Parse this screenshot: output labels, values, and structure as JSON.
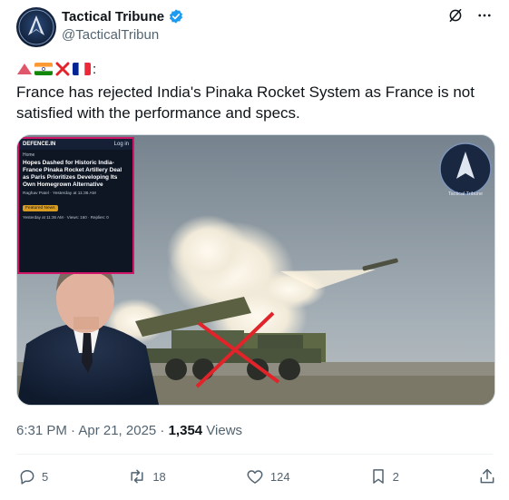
{
  "author": {
    "display_name": "Tactical Tribune",
    "handle": "@TacticalTribun"
  },
  "tweet": {
    "emoji_suffix": ":",
    "text": "France has rejected India's Pinaka Rocket System as France is not satisfied with the performance and specs."
  },
  "media": {
    "inset": {
      "site_label": "DEFENCE.IN",
      "login": "Log in",
      "breadcrumb": "Home",
      "headline": "Hopes Dashed for Historic India-France Pinaka Rocket Artillery Deal as Paris Prioritizes Developing Its Own Homegrown Alternative",
      "author_line": "Raghav Patel  ·  Yesterday at 11:36 AM",
      "tag": "Featured News",
      "stats": "Yesterday at 11:36 AM  ·  Views: 160  ·  Replies: 0"
    },
    "watermark": "Tactical Tribune"
  },
  "meta": {
    "time": "6:31 PM · Apr 21, 2025 · ",
    "views_count": "1,354",
    "views_label": " Views"
  },
  "stats": {
    "replies": "5",
    "reposts": "18",
    "likes": "124",
    "bookmarks": "2"
  },
  "colors": {
    "verified": "#1d9bf0",
    "text": "#0f1419",
    "secondary": "#536471",
    "cross": "#e0242a",
    "inset_border": "#d1166a"
  }
}
